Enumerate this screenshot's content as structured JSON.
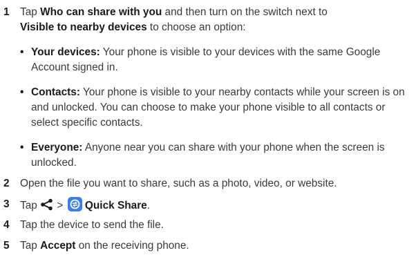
{
  "step1": {
    "num": "1",
    "t1": "Tap ",
    "b1": "Who can share with you",
    "t2": " and then turn on the switch next to ",
    "b2": "Visible to nearby devices",
    "t3": " to choose an option:"
  },
  "bullets": [
    {
      "title": "Your devices:",
      "text": " Your phone is visible to your devices with the same Google Account signed in."
    },
    {
      "title": "Contacts:",
      "text": " Your phone is visible to your nearby contacts while your screen is on and unlocked. You can choose to make your phone visible to all contacts or select specific contacts."
    },
    {
      "title": "Everyone:",
      "text": " Anyone near you can share with your phone when the screen is unlocked."
    }
  ],
  "bullet_symbol": "•",
  "step2": {
    "num": "2",
    "text": "Open the file you want to share, such as a photo, video, or website."
  },
  "step3": {
    "num": "3",
    "t1": "Tap ",
    "sep": " > ",
    "b1": "Quick Share",
    "t2": ".",
    "share_icon": "share-icon",
    "quick_share_icon": "quick-share-icon",
    "quick_share_color": "#3b7de9"
  },
  "step4": {
    "num": "4",
    "text": "Tap the device to send the file."
  },
  "step5": {
    "num": "5",
    "t1": "Tap ",
    "b1": "Accept",
    "t2": " on the receiving phone."
  }
}
